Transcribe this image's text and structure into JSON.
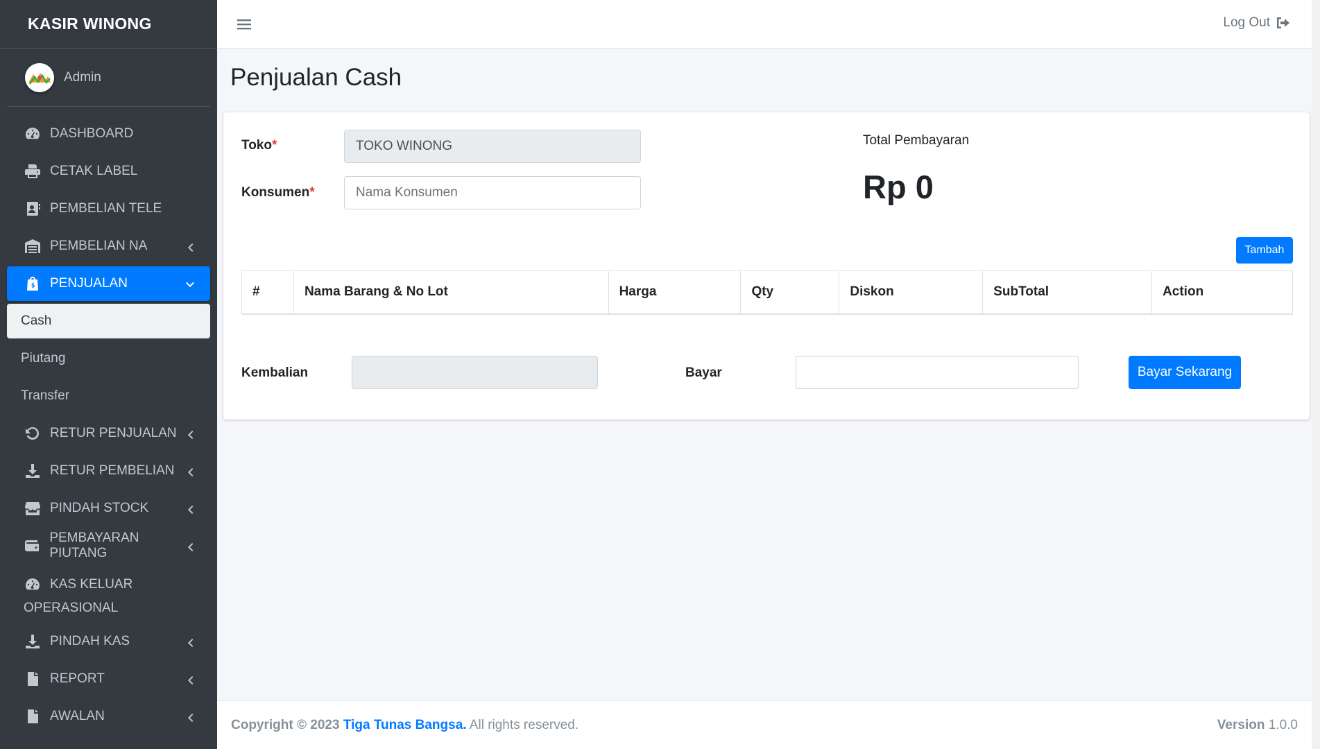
{
  "brand": {
    "name": "KASIR WINONG"
  },
  "user": {
    "name": "Admin"
  },
  "sidebar": {
    "items": [
      {
        "label": "DASHBOARD",
        "icon": "tachometer-icon"
      },
      {
        "label": "CETAK LABEL",
        "icon": "print-icon"
      },
      {
        "label": "PEMBELIAN TELE",
        "icon": "contact-book-icon"
      },
      {
        "label": "PEMBELIAN NA",
        "icon": "warehouse-icon"
      },
      {
        "label": "PENJUALAN",
        "icon": "shopping-bag-icon"
      },
      {
        "label": "RETUR PENJUALAN",
        "icon": "undo-icon"
      },
      {
        "label": "RETUR PEMBELIAN",
        "icon": "download-icon"
      },
      {
        "label": "PINDAH STOCK",
        "icon": "store-icon"
      },
      {
        "label": "PEMBAYARAN PIUTANG",
        "icon": "wallet-icon"
      },
      {
        "label_line1": "KAS KELUAR",
        "label_line2": "OPERASIONAL",
        "icon": "tachometer-icon"
      },
      {
        "label": "PINDAH KAS",
        "icon": "download-icon"
      },
      {
        "label": "REPORT",
        "icon": "file-icon"
      },
      {
        "label": "AWALAN",
        "icon": "file-icon"
      }
    ],
    "sub_items": [
      "Cash",
      "Piutang",
      "Transfer"
    ]
  },
  "header": {
    "logout_label": "Log Out"
  },
  "page": {
    "title": "Penjualan Cash"
  },
  "form": {
    "toko_label": "Toko",
    "toko_value": "TOKO WINONG",
    "konsumen_label": "Konsumen",
    "konsumen_placeholder": "Nama Konsumen",
    "required_mark": "*",
    "total_label": "Total Pembayaran",
    "total_value": "Rp 0",
    "add_button": "Tambah",
    "kembalian_label": "Kembalian",
    "bayar_label": "Bayar",
    "pay_button": "Bayar Sekarang"
  },
  "table": {
    "headers": [
      "#",
      "Nama Barang & No Lot",
      "Harga",
      "Qty",
      "Diskon",
      "SubTotal",
      "Action"
    ]
  },
  "footer": {
    "copyright_prefix": "Copyright © 2023",
    "company": "Tiga Tunas Bangsa.",
    "rights": "All rights reserved.",
    "version_label": "Version",
    "version_value": "1.0.0"
  },
  "colors": {
    "primary": "#007bff",
    "sidebar_bg": "#343a40",
    "danger": "#dc3545"
  }
}
